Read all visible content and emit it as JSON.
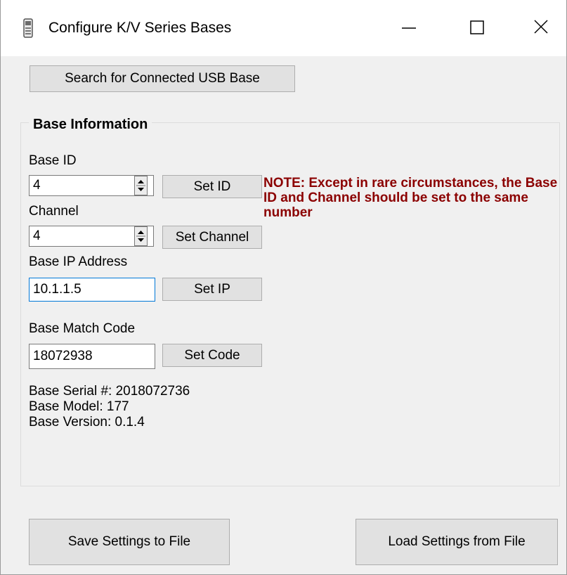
{
  "window": {
    "title": "Configure K/V Series Bases",
    "icon": "device-icon",
    "controls": [
      "minimize-icon",
      "maximize-icon",
      "close-icon"
    ]
  },
  "search_button": {
    "label": "Search for Connected USB Base"
  },
  "group": {
    "title": "Base Information",
    "base_id": {
      "label": "Base ID",
      "value": "4",
      "button": "Set ID"
    },
    "channel": {
      "label": "Channel",
      "value": "4",
      "button": "Set Channel"
    },
    "ip": {
      "label": "Base IP Address",
      "value": "10.1.1.5",
      "button": "Set IP"
    },
    "match_code": {
      "label": "Base Match Code",
      "value": "18072938",
      "button": "Set Code"
    },
    "note": "NOTE:  Except in rare circumstances, the Base ID and Channel should be set to the same number",
    "serial": "Base Serial #: 2018072736",
    "model": "Base Model: 177",
    "version": "Base Version: 0.1.4"
  },
  "footer": {
    "save_label": "Save Settings to File",
    "load_label": "Load Settings from File"
  },
  "colors": {
    "note": "#8b0000",
    "focus_border": "#0078d7",
    "button_face": "#e1e1e1"
  }
}
